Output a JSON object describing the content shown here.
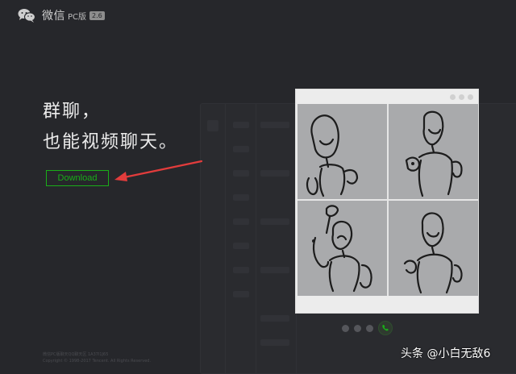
{
  "header": {
    "app_name": "微信",
    "app_sub": "PC版",
    "version": "2.6",
    "logo_icon": "wechat-logo-icon"
  },
  "hero": {
    "line1": "群聊，",
    "line2": "也能视频聊天。",
    "download_label": "Download",
    "accent_color": "#1aad19",
    "arrow_color": "#e23c3c"
  },
  "video_call": {
    "participants": 4,
    "call_icon": "phone-icon"
  },
  "footer": {
    "line1": "微信PC版聊天QQ聊天区 1A37I1J65",
    "line2": "Copyright © 1998-2017 Tencent. All Rights Reserved."
  },
  "watermark": {
    "text": "头条 @小白无敌6"
  }
}
